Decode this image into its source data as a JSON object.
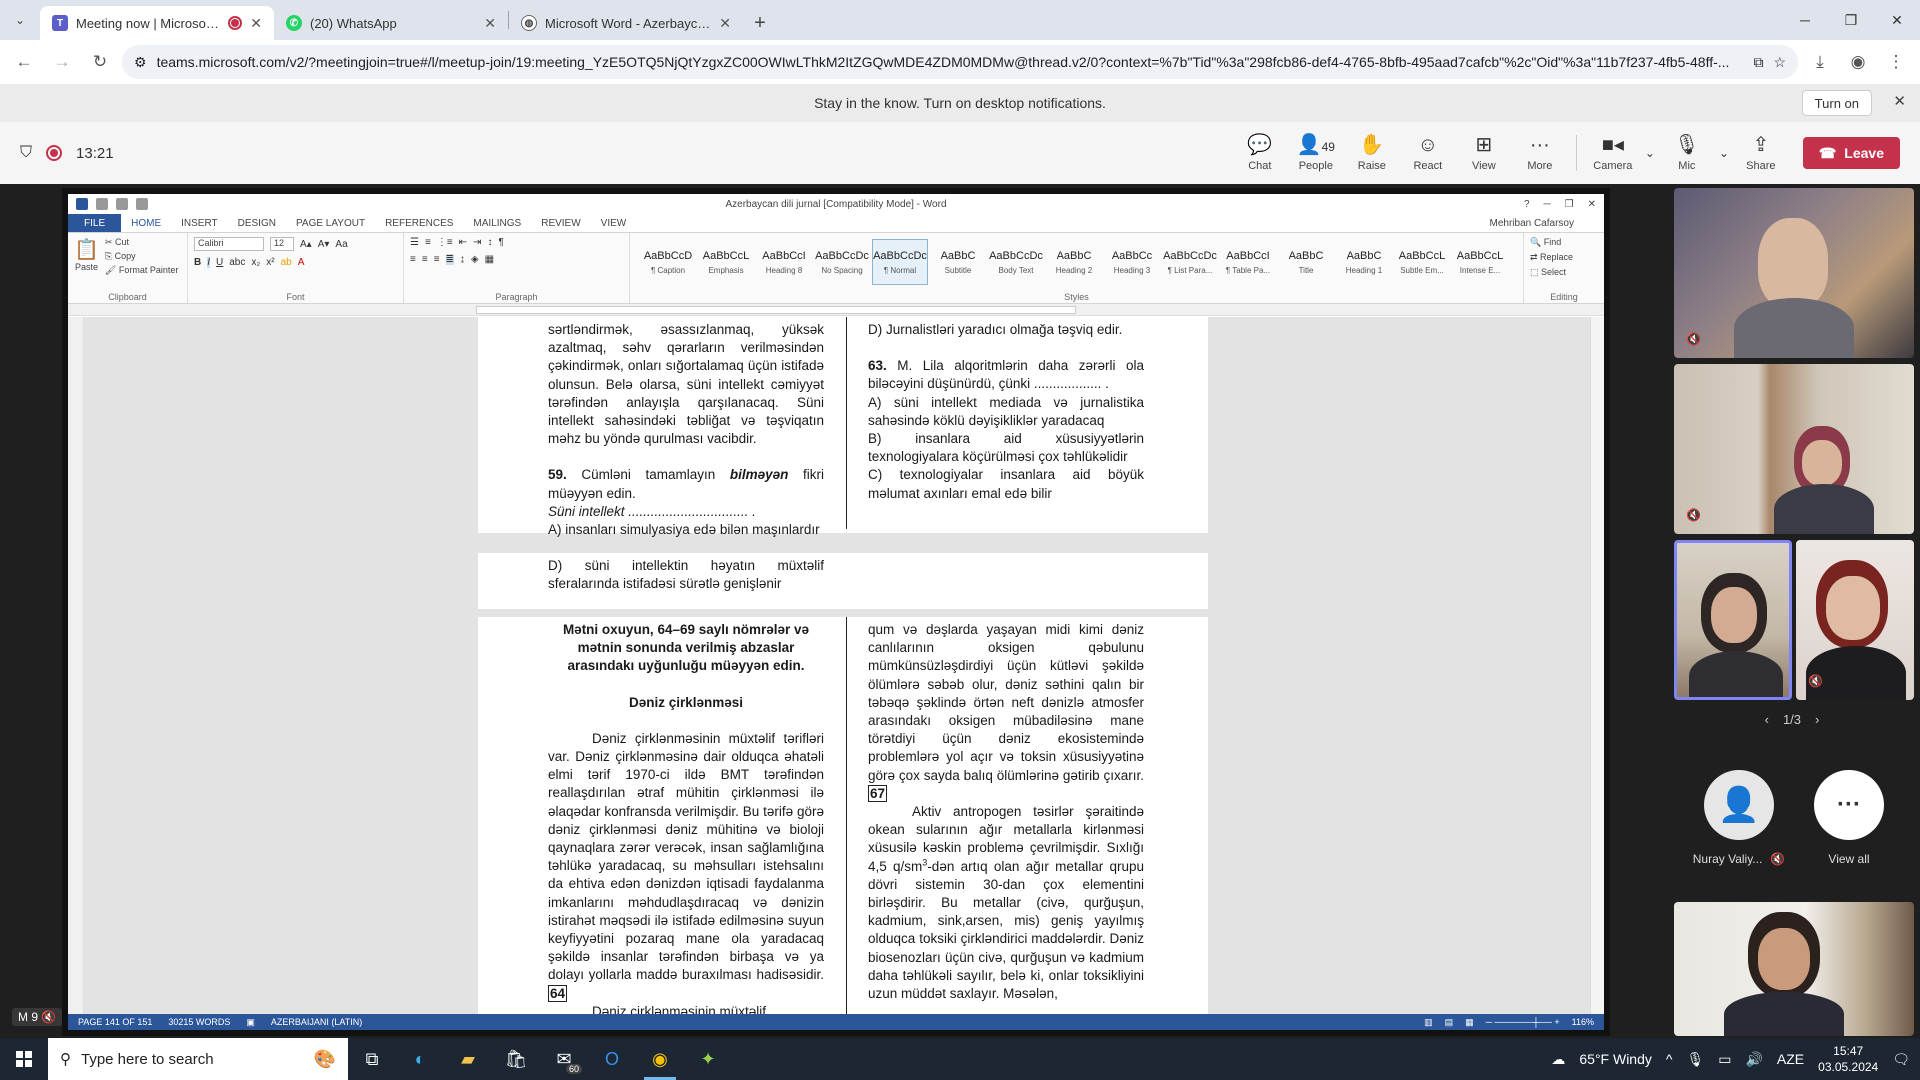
{
  "browser": {
    "tabs": [
      {
        "title": "Meeting now | Microsoft Te",
        "active": true
      },
      {
        "title": "(20) WhatsApp",
        "active": false
      },
      {
        "title": "Microsoft Word - Azerbaycan-d",
        "active": false
      }
    ],
    "url": "teams.microsoft.com/v2/?meetingjoin=true#/l/meetup-join/19:meeting_YzE5OTQ5NjQtYzgxZC00OWIwLThkM2ItZGQwMDE4ZDM0MDMw@thread.v2/0?context=%7b\"Tid\"%3a\"298fcb86-def4-4765-8bfb-495aad7cafcb\"%2c\"Oid\"%3a\"11b7f237-4fb5-48ff-..."
  },
  "notification": {
    "message": "Stay in the know. Turn on desktop notifications.",
    "turn_on_label": "Turn on"
  },
  "meeting": {
    "timer": "13:21",
    "people_count": "49",
    "actions": {
      "chat": "Chat",
      "people": "People",
      "raise": "Raise",
      "react": "React",
      "view": "View",
      "more": "More",
      "camera": "Camera",
      "mic": "Mic",
      "share": "Share"
    },
    "leave_label": "Leave"
  },
  "word": {
    "title": "Azerbaycan dili jurnal [Compatibility Mode] - Word",
    "user": "Mehriban Cafarsoy",
    "ribbon_tabs": [
      "FILE",
      "HOME",
      "INSERT",
      "DESIGN",
      "PAGE LAYOUT",
      "REFERENCES",
      "MAILINGS",
      "REVIEW",
      "VIEW"
    ],
    "clipboard": {
      "paste": "Paste",
      "cut": "Cut",
      "copy": "Copy",
      "format_painter": "Format Painter",
      "group": "Clipboard"
    },
    "font": {
      "name": "Calibri",
      "size": "12",
      "group": "Font"
    },
    "paragraph_group": "Paragraph",
    "styles_group": "Styles",
    "editing": {
      "find": "Find",
      "replace": "Replace",
      "select": "Select",
      "group": "Editing"
    },
    "styles": [
      {
        "sample": "AaBbCcD",
        "name": "¶ Caption"
      },
      {
        "sample": "AaBbCcL",
        "name": "Emphasis"
      },
      {
        "sample": "AaBbCcI",
        "name": "Heading 8"
      },
      {
        "sample": "AaBbCcDc",
        "name": "No Spacing"
      },
      {
        "sample": "AaBbCcDc",
        "name": "¶ Normal"
      },
      {
        "sample": "AaBbC",
        "name": "Subtitle"
      },
      {
        "sample": "AaBbCcDc",
        "name": "Body Text"
      },
      {
        "sample": "AaBbC",
        "name": "Heading 2"
      },
      {
        "sample": "AaBbCc",
        "name": "Heading 3"
      },
      {
        "sample": "AaBbCcDc",
        "name": "¶ List Para..."
      },
      {
        "sample": "AaBbCcI",
        "name": "¶ Table Pa..."
      },
      {
        "sample": "AaBbC",
        "name": "Title"
      },
      {
        "sample": "AaBbC",
        "name": "Heading 1"
      },
      {
        "sample": "AaBbCcL",
        "name": "Subtle Em..."
      },
      {
        "sample": "AaBbCcL",
        "name": "Intense E..."
      }
    ],
    "doc": {
      "p1_colA": "sərtləndirmək, əsassızlanmaq, yüksək azaltmaq, səhv qərarların verilməsindən çəkindirmək, onları sığortalamaq üçün istifadə olunsun. Belə olarsa, süni intellekt cəmiyyət tərəfindən anlayışla qarşılanacaq. Süni intellekt sahəsindəki təbliğat və təşviqatın məhz bu yöndə qurulması vacibdir.",
      "q59_num": "59.",
      "q59_a": "Cümləni tamamlayın",
      "q59_em": "bilməyən",
      "q59_b": "fikri müəyyən edin.",
      "q59_stem": "Süni intellekt ................................ .",
      "q59_A": "A) insanları simulyasiya edə bilən maşınlardır",
      "q59_D": "D) süni intellektin həyatın müxtəlif sferalarında istifadəsi sürətlə genişlənir",
      "colB_D": "D) Jurnalistləri yaradıcı olmağa təşviq edir.",
      "q63_num": "63.",
      "q63_text": "M. Lila alqoritmlərin daha zərərli ola biləcəyini düşünürdü, çünki .................. .",
      "q63_A": "A) süni intellekt mediada və jurnalistika sahəsində köklü dəyişikliklər yaradacaq",
      "q63_B": "B) insanlara aid xüsusiyyətlərin texnologiyalara köçürülməsi çox təhlükəlidir",
      "q63_C": "C) texnologiyalar insanlara aid böyük məlumat axınları emal edə bilir",
      "task_heading": "Mətni oxuyun, 64–69 saylı nömrələr və mətnin sonunda verilmiş abzaslar arasındakı uyğunluğu müəyyən edin.",
      "text_title": "Dəniz çirklənməsi",
      "para1": "Dəniz çirklənməsinin müxtəlif tərifləri var. Dəniz çirklənməsinə dair olduqca əhatəli elmi tərif 1970-ci ildə BMT tərəfindən reallaşdırılan ətraf mühitin çirklənməsi ilə əlaqədar konfransda verilmişdir. Bu tərifə görə dəniz çirklənməsi dəniz mühitinə və bioloji qaynaqlara zərər verəcək, insan sağlamlığına təhlükə yaradacaq, su məhsulları istehsalını da ehtiva edən dənizdən iqtisadi faydalanma imkanlarını məhdudlaşdıracaq və dənizin istirahət məqsədi ilə istifadə edilməsinə suyun keyfiyyətini pozaraq mane ola yaradacaq şəkildə insanlar tərəfindən birbaşa və ya dolayı yollarla maddə buraxılması hadisəsidir.",
      "mark64": "64",
      "para1_next": "Dəniz çirklənməsinin müxtəlif",
      "colB_para": "qum və dəşlarda yaşayan midi kimi dəniz canlılarının oksigen qəbulunu mümkünsüzləşdirdiyi üçün kütləvi şəkildə ölümlərə səbəb olur, dəniz səthini qalın bir təbəqə şəklində örtən neft dənizlə atmosfer arasındakı oksigen mübadiləsinə mane törətdiyi üçün dəniz ekosistemində problemlərə yol açır və toksin xüsusiyyətinə görə çox sayda balıq ölümlərinə gətirib çıxarır.",
      "mark67": "67",
      "colB_para2_a": "Aktiv antropogen təsirlər şəraitində okean sularının ağır metallarla kirlənməsi xüsusilə kəskin problemə çevrilmişdir. Sıxlığı 4,5 q/sm",
      "colB_para2_sup": "3",
      "colB_para2_b": "-dən artıq olan ağır metallar qrupu dövri sistemin 30-dan çox elementini birləşdirir. Bu metallar (civə, qurğuşun, kadmium, sink,arsen, mis) geniş yayılmış olduqca toksiki çirkləndirici maddələrdir. Dəniz biosenozları üçün civə, qurğuşun və kadmium daha təhlükəli sayılır, belə ki, onlar toksikliyini uzun müddət saxlayır. Məsələn,"
    },
    "status": {
      "page": "PAGE 141 OF 151",
      "words": "30215 WORDS",
      "language": "AZERBAIJANI (LATIN)",
      "zoom": "116%"
    }
  },
  "participants": {
    "pager": "1/3",
    "named": {
      "name": "Nuray Valiy...",
      "view_all": "View all"
    },
    "self_label": "M 9"
  },
  "taskbar": {
    "search_placeholder": "Type here to search",
    "mail_badge": "60",
    "weather": "65°F  Windy",
    "lang": "AZE",
    "time": "15:47",
    "date": "03.05.2024"
  }
}
